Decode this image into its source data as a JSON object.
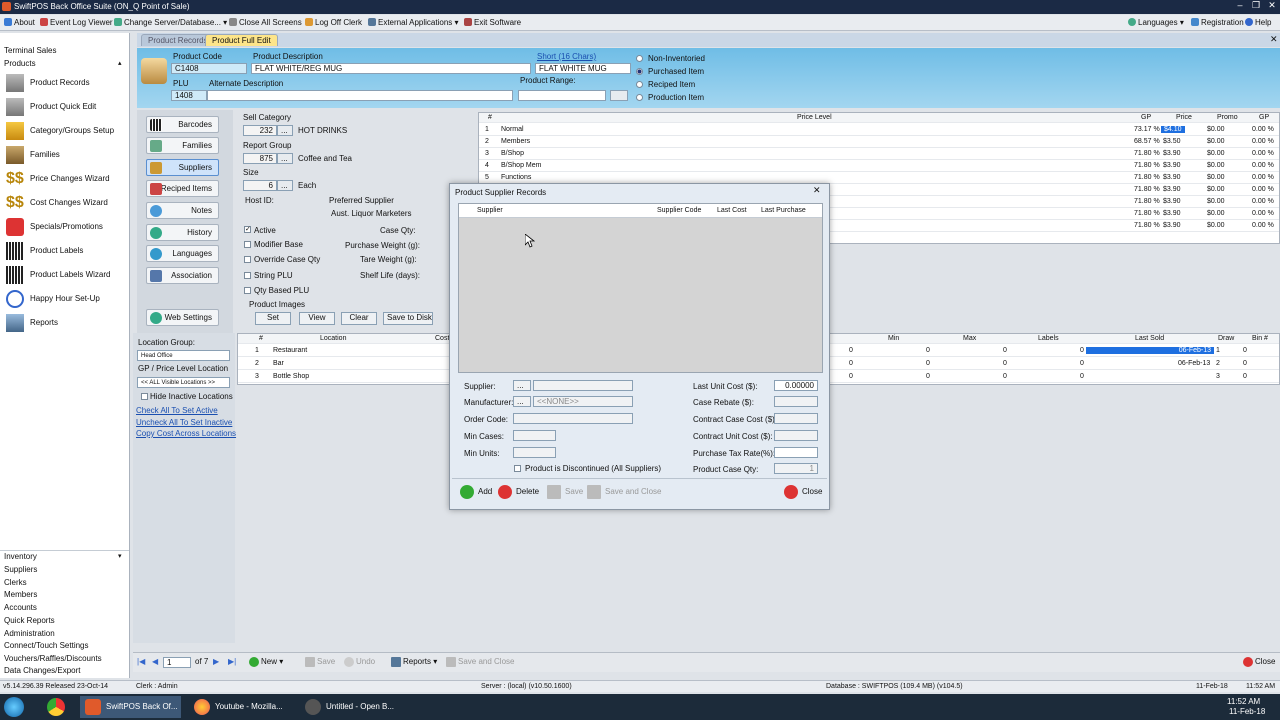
{
  "window": {
    "title": "SwiftPOS Back Office Suite (ON_Q Point of Sale)"
  },
  "menu": {
    "about": "About",
    "event_log": "Event Log Viewer",
    "change_server": "Change Server/Database...",
    "close_all": "Close All Screens",
    "log_off": "Log Off Clerk",
    "external": "External Applications",
    "exit": "Exit Software",
    "languages": "Languages",
    "registration": "Registration",
    "help": "Help"
  },
  "nav": {
    "terminal_sales": "Terminal Sales",
    "products": "Products",
    "items": [
      "Product Records",
      "Product Quick Edit",
      "Category/Groups Setup",
      "Families",
      "Price Changes Wizard",
      "Cost Changes Wizard",
      "Specials/Promotions",
      "Product Labels",
      "Product Labels Wizard",
      "Happy Hour Set-Up",
      "Reports"
    ],
    "sections": [
      "Inventory",
      "Suppliers",
      "Clerks",
      "Members",
      "Accounts",
      "Quick Reports",
      "Administration",
      "Connect/Touch Settings",
      "Vouchers/Raffles/Discounts",
      "Data Changes/Export"
    ]
  },
  "tabs": {
    "product_records": "Product Records",
    "product_full_edit": "Product Full Edit"
  },
  "header": {
    "product_code_label": "Product Code",
    "product_code": "C1408",
    "desc_label": "Product Description",
    "desc": "FLAT WHITE/REG MUG",
    "short_label": "Short (16 Chars)",
    "short": "FLAT WHITE MUG",
    "plu_label": "PLU",
    "plu": "1408",
    "alt_desc_label": "Alternate Description",
    "range_label": "Product Range:",
    "radios": [
      "Non-Inventoried",
      "Purchased Item",
      "Reciped Item",
      "Production Item"
    ]
  },
  "side_buttons": [
    "Barcodes",
    "Families",
    "Suppliers",
    "Reciped Items",
    "Notes",
    "History",
    "Languages",
    "Association",
    "Web Settings"
  ],
  "detail": {
    "sell_category_label": "Sell Category",
    "sell_cat_code": "232",
    "sell_cat_name": "HOT DRINKS",
    "report_group_label": "Report Group",
    "rg_code": "875",
    "rg_name": "Coffee and Tea",
    "size_label": "Size",
    "size_code": "6",
    "size_name": "Each",
    "host_id_label": "Host ID:",
    "pref_supplier_label": "Preferred Supplier",
    "pref_supplier": "Aust. Liquor Marketers",
    "checks": [
      "Active",
      "Modifier Base",
      "Override Case Qty",
      "String PLU",
      "Qty Based PLU"
    ],
    "case_qty": "Case Qty:",
    "purchase_weight": "Purchase Weight (g):",
    "tare_weight": "Tare Weight (g):",
    "shelf_life": "Shelf Life (days):",
    "images_label": "Product Images",
    "img_buttons": [
      "Set",
      "View",
      "Clear",
      "Save to Disk"
    ]
  },
  "price_grid": {
    "headers": [
      "#",
      "Price Level",
      "GP",
      "Price",
      "Promo",
      "GP"
    ],
    "rows": [
      [
        "1",
        "Normal",
        "73.17 %",
        "$4.10",
        "$0.00",
        "0.00 %"
      ],
      [
        "2",
        "Members",
        "68.57 %",
        "$3.50",
        "$0.00",
        "0.00 %"
      ],
      [
        "3",
        "B/Shop",
        "71.80 %",
        "$3.90",
        "$0.00",
        "0.00 %"
      ],
      [
        "4",
        "B/Shop Mem",
        "71.80 %",
        "$3.90",
        "$0.00",
        "0.00 %"
      ],
      [
        "5",
        "Functions",
        "71.80 %",
        "$3.90",
        "$0.00",
        "0.00 %"
      ],
      [
        "",
        "",
        "71.80 %",
        "$3.90",
        "$0.00",
        "0.00 %"
      ],
      [
        "",
        "",
        "71.80 %",
        "$3.90",
        "$0.00",
        "0.00 %"
      ],
      [
        "",
        "",
        "71.80 %",
        "$3.90",
        "$0.00",
        "0.00 %"
      ],
      [
        "",
        "",
        "71.80 %",
        "$3.90",
        "$0.00",
        "0.00 %"
      ]
    ]
  },
  "location": {
    "group_label": "Location Group:",
    "group_value": "Head Office",
    "gp_label": "GP / Price Level Location",
    "gp_value": "<< ALL Visible Locations >>",
    "hide_inactive": "Hide Inactive Locations",
    "links": [
      "Check All To Set Active",
      "Uncheck All To Set Inactive",
      "Copy Cost Across Locations"
    ]
  },
  "loc_grid": {
    "headers": [
      "#",
      "Location",
      "Cost",
      "Min",
      "Max",
      "Labels",
      "Last Sold",
      "Draw",
      "Bin #"
    ],
    "rows": [
      [
        "1",
        "Restaurant",
        "0",
        "0",
        "0",
        "0",
        "06-Feb-13",
        "1",
        "0"
      ],
      [
        "2",
        "Bar",
        "0",
        "0",
        "0",
        "0",
        "06-Feb-13",
        "2",
        "0"
      ],
      [
        "3",
        "Bottle Shop",
        "0",
        "0",
        "0",
        "0",
        "",
        "3",
        "0"
      ]
    ]
  },
  "dialog": {
    "title": "Product Supplier Records",
    "grid_headers": [
      "Supplier",
      "Supplier Code",
      "Last Cost",
      "Last Purchase"
    ],
    "supplier": "Supplier:",
    "manufacturer": "Manufacturer:",
    "manufacturer_value": "<<NONE>>",
    "order_code": "Order Code:",
    "min_cases": "Min Cases:",
    "min_units": "Min Units:",
    "discontinued": "Product is Discontinued (All Suppliers)",
    "last_unit_cost": "Last Unit Cost ($):",
    "last_unit_cost_value": "0.00000",
    "case_rebate": "Case Rebate ($):",
    "contract_case_cost": "Contract Case Cost ($):",
    "contract_unit_cost": "Contract Unit Cost ($):",
    "purchase_tax": "Purchase Tax Rate(%):",
    "case_qty": "Product Case Qty:",
    "case_qty_value": "1",
    "buttons": {
      "add": "Add",
      "delete": "Delete",
      "save": "Save",
      "save_close": "Save and Close",
      "close": "Close"
    }
  },
  "toolbar": {
    "page": "1",
    "of": "of 7",
    "new": "New",
    "save": "Save",
    "undo": "Undo",
    "reports": "Reports",
    "save_close": "Save and Close",
    "close": "Close"
  },
  "status": {
    "version": "v5.14.296.39 Released 23-Oct-14",
    "clerk": "Clerk : Admin",
    "server": "Server : (local) (v10.50.1600)",
    "database": "Database : SWIFTPOS (109.4 MB) (v104.5)",
    "date": "11-Feb-18",
    "time": "11:52 AM"
  },
  "taskbar": {
    "apps": [
      "SwiftPOS Back Of...",
      "Youtube - Mozilla...",
      "Untitled - Open B..."
    ],
    "time": "11:52 AM",
    "date": "11-Feb-18"
  },
  "colors": {
    "header_blue": "#6fbde6",
    "selection": "#1e6fe0",
    "taskbar": "#1c2b3a"
  }
}
